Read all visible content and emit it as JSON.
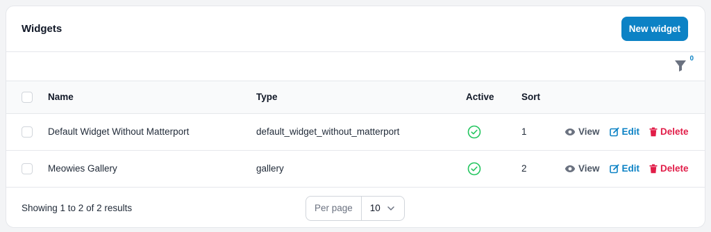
{
  "header": {
    "title": "Widgets",
    "new_button_label": "New widget"
  },
  "toolbar": {
    "filter_count": "0",
    "filter_icon": "funnel-icon"
  },
  "table": {
    "columns": {
      "name": "Name",
      "type": "Type",
      "active": "Active",
      "sort": "Sort"
    },
    "rows": [
      {
        "name": "Default Widget Without Matterport",
        "type": "default_widget_without_matterport",
        "active": true,
        "sort": "1"
      },
      {
        "name": "Meowies Gallery",
        "type": "gallery",
        "active": true,
        "sort": "2"
      }
    ],
    "actions": {
      "view": "View",
      "edit": "Edit",
      "delete": "Delete"
    }
  },
  "footer": {
    "summary": "Showing 1 to 2 of 2 results",
    "per_page_label": "Per page",
    "per_page_value": "10"
  },
  "colors": {
    "primary": "#0c82c5",
    "success": "#22c55e",
    "danger": "#e11d48",
    "muted": "#6b7280"
  }
}
